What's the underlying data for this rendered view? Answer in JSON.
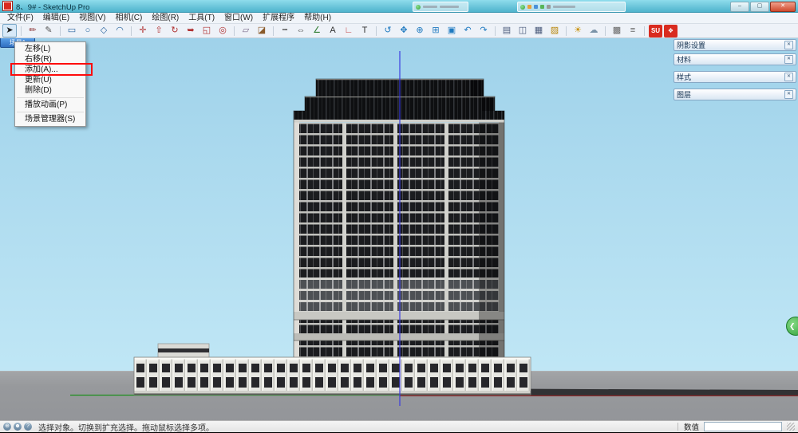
{
  "colors": {
    "titlebar_teal": "#4fb3cc",
    "accent_red": "#d92b1f",
    "highlight_red": "#ff0b0b",
    "sky_blue": "#a6d9ee",
    "ground_gray": "#97999c",
    "scene_tab_blue": "#2f6fc0"
  },
  "window": {
    "title": "8、9# - SketchUp Pro",
    "controls": {
      "minimize": "–",
      "maximize": "▢",
      "close": "✕"
    }
  },
  "menu_bar": {
    "items": [
      {
        "id": "file",
        "label": "文件(F)"
      },
      {
        "id": "edit",
        "label": "编辑(E)"
      },
      {
        "id": "view",
        "label": "视图(V)"
      },
      {
        "id": "camera",
        "label": "相机(C)"
      },
      {
        "id": "draw",
        "label": "绘图(R)"
      },
      {
        "id": "tools",
        "label": "工具(T)"
      },
      {
        "id": "window",
        "label": "窗口(W)"
      },
      {
        "id": "extensions",
        "label": "扩展程序"
      },
      {
        "id": "help",
        "label": "帮助(H)"
      }
    ]
  },
  "toolbar": {
    "tools": [
      {
        "id": "select",
        "glyph": "➤",
        "color": "#1f1f1f",
        "active": true
      },
      {
        "type": "separator"
      },
      {
        "id": "line",
        "glyph": "✏",
        "color": "#8a2f2f"
      },
      {
        "id": "freehand",
        "glyph": "✎",
        "color": "#555555"
      },
      {
        "type": "separator"
      },
      {
        "id": "rectangle",
        "glyph": "▭",
        "color": "#27639e"
      },
      {
        "id": "circle",
        "glyph": "○",
        "color": "#27639e"
      },
      {
        "id": "polygon",
        "glyph": "◇",
        "color": "#27639e"
      },
      {
        "id": "arc",
        "glyph": "◠",
        "color": "#27639e"
      },
      {
        "type": "separator"
      },
      {
        "id": "move",
        "glyph": "✛",
        "color": "#b03030"
      },
      {
        "id": "push-pull",
        "glyph": "⇧",
        "color": "#b03030"
      },
      {
        "id": "rotate",
        "glyph": "↻",
        "color": "#b03030"
      },
      {
        "id": "follow-me",
        "glyph": "➥",
        "color": "#b03030"
      },
      {
        "id": "scale",
        "glyph": "◱",
        "color": "#b03030"
      },
      {
        "id": "offset",
        "glyph": "◎",
        "color": "#b03030"
      },
      {
        "type": "separator"
      },
      {
        "id": "eraser",
        "glyph": "▱",
        "color": "#7a6a8a"
      },
      {
        "id": "paint-bucket",
        "glyph": "◪",
        "color": "#8a5a2a"
      },
      {
        "type": "separator"
      },
      {
        "id": "tape-measure",
        "glyph": "┅",
        "color": "#444444"
      },
      {
        "id": "dimensions",
        "glyph": "⇔",
        "color": "#444444"
      },
      {
        "id": "protractor",
        "glyph": "∠",
        "color": "#2e7d32"
      },
      {
        "id": "text",
        "glyph": "A",
        "color": "#333333"
      },
      {
        "id": "axes",
        "glyph": "∟",
        "color": "#c23b3b"
      },
      {
        "id": "3d-text",
        "glyph": "T",
        "color": "#333333"
      },
      {
        "type": "separator"
      },
      {
        "id": "orbit",
        "glyph": "↺",
        "color": "#1f7ac0"
      },
      {
        "id": "pan",
        "glyph": "✥",
        "color": "#1f7ac0"
      },
      {
        "id": "zoom",
        "glyph": "⊕",
        "color": "#1f7ac0"
      },
      {
        "id": "zoom-window",
        "glyph": "⊞",
        "color": "#1f7ac0"
      },
      {
        "id": "zoom-extents",
        "glyph": "▣",
        "color": "#1f7ac0"
      },
      {
        "id": "previous-view",
        "glyph": "↶",
        "color": "#1f7ac0"
      },
      {
        "id": "next-view",
        "glyph": "↷",
        "color": "#1f7ac0"
      },
      {
        "type": "separator"
      },
      {
        "id": "front-view",
        "glyph": "▤",
        "color": "#4a5a7a"
      },
      {
        "id": "iso-view",
        "glyph": "◫",
        "color": "#4a5a7a"
      },
      {
        "id": "top-view",
        "glyph": "▦",
        "color": "#4a5a7a"
      },
      {
        "id": "section-plane",
        "glyph": "▨",
        "color": "#b8860b"
      },
      {
        "type": "separator"
      },
      {
        "id": "shadows",
        "glyph": "☀",
        "color": "#c98f00"
      },
      {
        "id": "fog",
        "glyph": "☁",
        "color": "#7a93a8"
      },
      {
        "type": "separator"
      },
      {
        "id": "styles",
        "glyph": "▩",
        "color": "#666666"
      },
      {
        "id": "layers",
        "glyph": "≡",
        "color": "#666666"
      },
      {
        "type": "separator"
      },
      {
        "id": "suapp-1",
        "type": "logo",
        "glyph": "SU"
      },
      {
        "id": "suapp-2",
        "type": "logo",
        "glyph": "❖"
      }
    ]
  },
  "scene_tab": {
    "label": "场景1"
  },
  "context_menu": {
    "items": [
      {
        "id": "move-left",
        "label": "左移(L)"
      },
      {
        "id": "move-right",
        "label": "右移(R)"
      },
      {
        "id": "add",
        "label": "添加(A)...",
        "highlighted": true
      },
      {
        "id": "update",
        "label": "更新(U)"
      },
      {
        "id": "delete",
        "label": "删除(D)"
      },
      {
        "type": "separator"
      },
      {
        "id": "play-animation",
        "label": "播放动画(P)"
      },
      {
        "type": "separator"
      },
      {
        "id": "scene-manager",
        "label": "场景管理器(S)"
      }
    ]
  },
  "right_panels": {
    "button_glyph": "✕",
    "panels": [
      {
        "id": "shadow-settings",
        "title": "阴影设置"
      },
      {
        "id": "materials",
        "title": "材料"
      },
      {
        "id": "styles",
        "title": "样式"
      },
      {
        "id": "layers",
        "title": "图层"
      }
    ]
  },
  "expand_toggle_glyph": "❮",
  "status_bar": {
    "icons": [
      {
        "id": "geolocation",
        "glyph": "⊕"
      },
      {
        "id": "credits",
        "glyph": "☻"
      },
      {
        "id": "help",
        "glyph": "?"
      }
    ],
    "message": "选择对象。切换到扩充选择。拖动鼠标选择多项。",
    "measurement_label": "数值",
    "measurement_value": ""
  }
}
